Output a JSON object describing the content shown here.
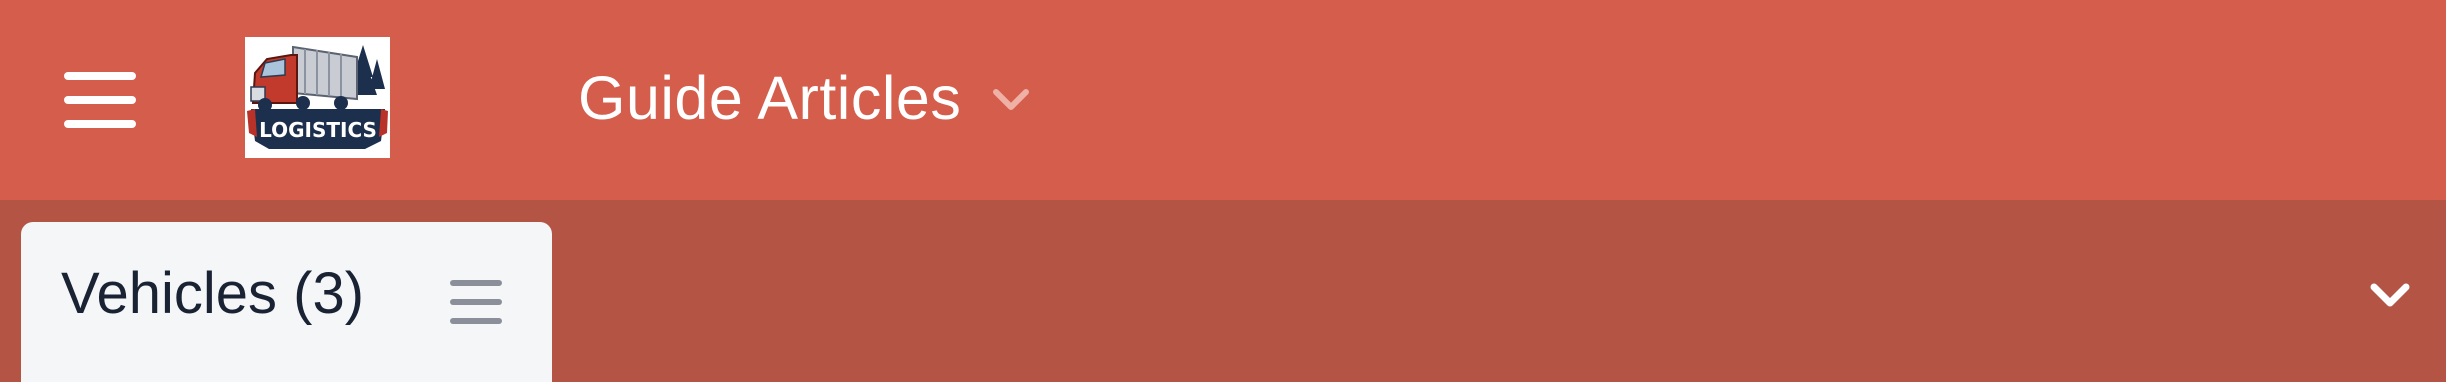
{
  "header": {
    "menu_icon": "hamburger-menu-icon",
    "logo_text": "LOGISTICS",
    "title": "Guide Articles",
    "title_chevron_icon": "chevron-down-icon"
  },
  "tabs": [
    {
      "label": "Vehicles (3)",
      "icon": "list-menu-icon"
    }
  ],
  "subbar": {
    "expand_icon": "chevron-down-icon"
  },
  "colors": {
    "header_bg": "#d45d4b",
    "subbar_bg": "#b45444",
    "tab_bg": "#f5f6f7",
    "tab_text": "#1a2334",
    "icon_gray": "#8a8f99"
  }
}
